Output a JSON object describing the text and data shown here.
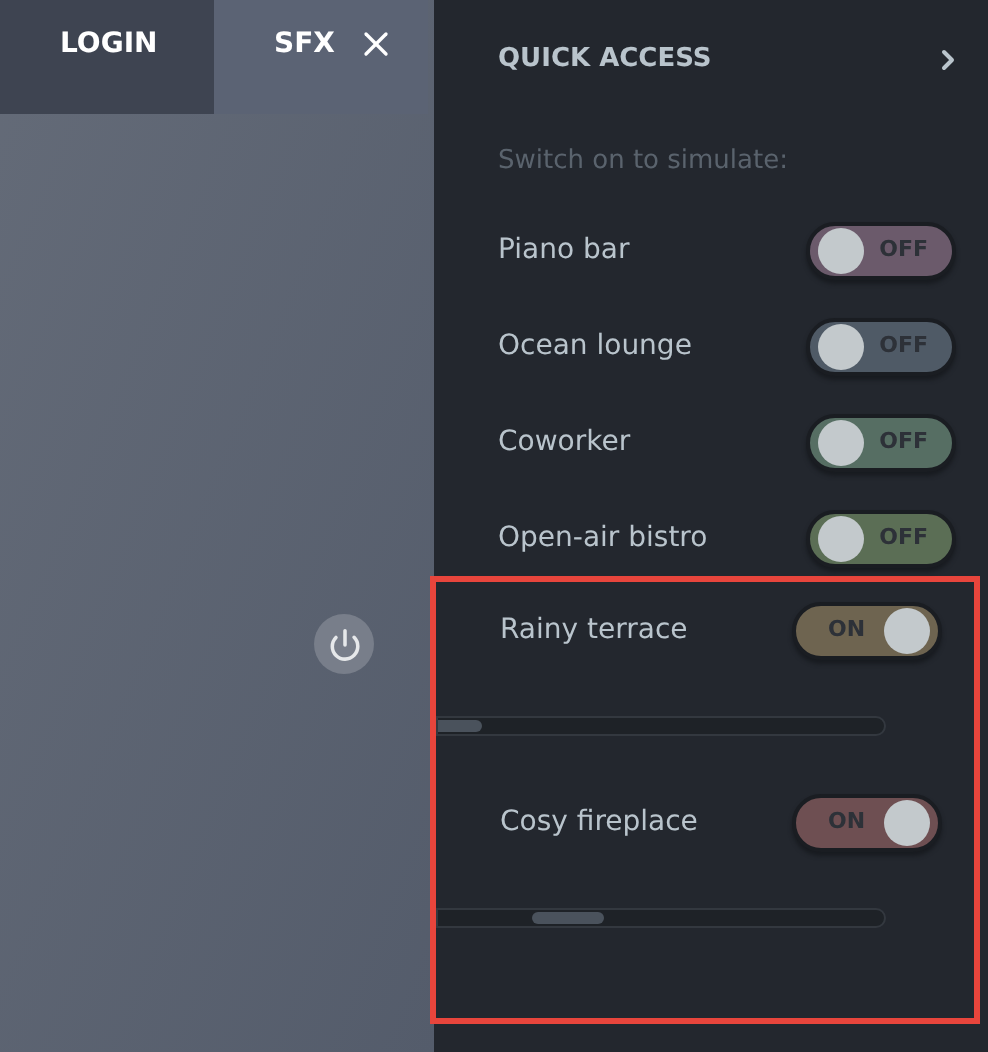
{
  "tabs": [
    {
      "label": "LOGIN",
      "selected": false
    },
    {
      "label": "SFX",
      "selected": true
    }
  ],
  "panel": {
    "title": "QUICK ACCESS",
    "subtitle": "Switch on to simulate:",
    "sounds": [
      {
        "name": "Piano bar",
        "on": false,
        "state_label": "OFF",
        "color": "#6b5a6b",
        "highlighted": false
      },
      {
        "name": "Ocean lounge",
        "on": false,
        "state_label": "OFF",
        "color": "#4f5a66",
        "highlighted": false
      },
      {
        "name": "Coworker",
        "on": false,
        "state_label": "OFF",
        "color": "#566e63",
        "highlighted": false
      },
      {
        "name": "Open-air bistro",
        "on": false,
        "state_label": "OFF",
        "color": "#5b6e55",
        "highlighted": false
      },
      {
        "name": "Rainy terrace",
        "on": true,
        "state_label": "ON",
        "color": "#6e6450",
        "highlighted": true,
        "volume": {
          "level": 0.02
        }
      },
      {
        "name": "Cosy fireplace",
        "on": true,
        "state_label": "ON",
        "color": "#6e4f52",
        "highlighted": true,
        "volume": {
          "level": 0.29
        }
      }
    ]
  }
}
